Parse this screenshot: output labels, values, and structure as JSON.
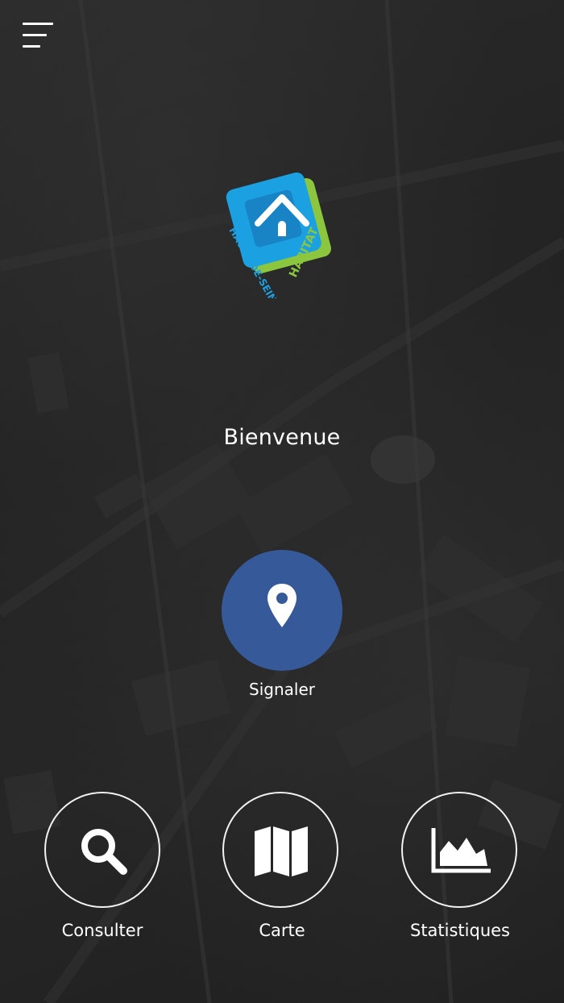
{
  "header": {
    "menu_icon": "hamburger-menu-icon"
  },
  "logo": {
    "brand_line1": "HAUTS-DE-SEINE",
    "brand_line2": "HABITAT",
    "icon": "house-icon",
    "colors": {
      "green": "#8cc63f",
      "blue": "#1ba1e2",
      "dark_blue": "#1565a8"
    }
  },
  "welcome_text": "Bienvenue",
  "primary_action": {
    "label": "Signaler",
    "icon": "map-pin-icon",
    "color": "#36599a"
  },
  "actions": [
    {
      "label": "Consulter",
      "icon": "search-icon"
    },
    {
      "label": "Carte",
      "icon": "map-icon"
    },
    {
      "label": "Statistiques",
      "icon": "area-chart-icon"
    }
  ],
  "colors": {
    "background": "#232323",
    "text": "#ffffff"
  }
}
